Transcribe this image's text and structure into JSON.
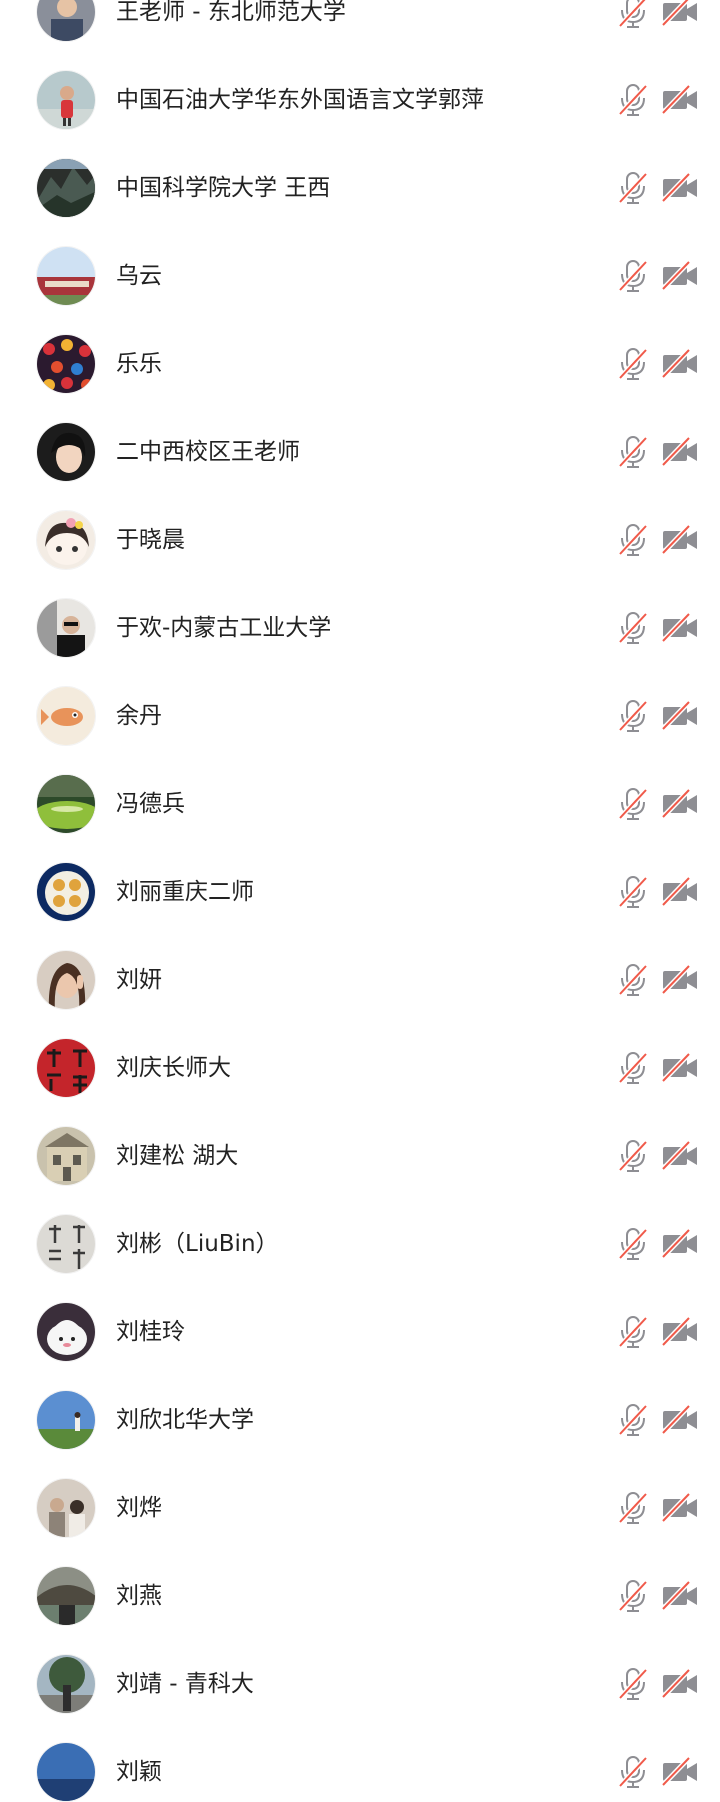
{
  "colors": {
    "icon_gray": "#8e8e93",
    "muted_red": "#f05a4a",
    "text": "#222222",
    "background": "#ffffff"
  },
  "participants": [
    {
      "name": "王老师 - 东北师范大学",
      "avatar": "person-photo",
      "mic": "muted",
      "camera": "off"
    },
    {
      "name": "中国石油大学华东外国语言文学郭萍",
      "avatar": "child-photo",
      "mic": "muted",
      "camera": "off"
    },
    {
      "name": "中国科学院大学 王西",
      "avatar": "mountain-landscape",
      "mic": "muted",
      "camera": "off"
    },
    {
      "name": "乌云",
      "avatar": "campus-building",
      "mic": "muted",
      "camera": "off"
    },
    {
      "name": "乐乐",
      "avatar": "lanterns",
      "mic": "muted",
      "camera": "off"
    },
    {
      "name": "二中西校区王老师",
      "avatar": "woman-portrait",
      "mic": "muted",
      "camera": "off"
    },
    {
      "name": "于晓晨",
      "avatar": "cartoon-girl",
      "mic": "muted",
      "camera": "off"
    },
    {
      "name": "于欢-内蒙古工业大学",
      "avatar": "man-with-sunglasses",
      "mic": "muted",
      "camera": "off"
    },
    {
      "name": "余丹",
      "avatar": "fish-illustration",
      "mic": "muted",
      "camera": "off"
    },
    {
      "name": "冯德兵",
      "avatar": "green-landscape",
      "mic": "muted",
      "camera": "off"
    },
    {
      "name": "刘丽重庆二师",
      "avatar": "food-plate",
      "mic": "muted",
      "camera": "off"
    },
    {
      "name": "刘妍",
      "avatar": "woman-waving",
      "mic": "muted",
      "camera": "off"
    },
    {
      "name": "刘庆长师大",
      "avatar": "calligraphy-red",
      "mic": "muted",
      "camera": "off"
    },
    {
      "name": "刘建松  湖大",
      "avatar": "old-building",
      "mic": "muted",
      "camera": "off"
    },
    {
      "name": "刘彬（LiuBin）",
      "avatar": "calligraphy-gray",
      "mic": "muted",
      "camera": "off"
    },
    {
      "name": "刘桂玲",
      "avatar": "white-toy",
      "mic": "muted",
      "camera": "off"
    },
    {
      "name": "刘欣北华大学",
      "avatar": "field-sky",
      "mic": "muted",
      "camera": "off"
    },
    {
      "name": "刘烨",
      "avatar": "people-photo",
      "mic": "muted",
      "camera": "off"
    },
    {
      "name": "刘燕",
      "avatar": "bridge-photo",
      "mic": "muted",
      "camera": "off"
    },
    {
      "name": "刘靖 - 青科大",
      "avatar": "tree-square",
      "mic": "muted",
      "camera": "off"
    },
    {
      "name": "刘颖",
      "avatar": "blue-sky",
      "mic": "muted",
      "camera": "off"
    }
  ]
}
